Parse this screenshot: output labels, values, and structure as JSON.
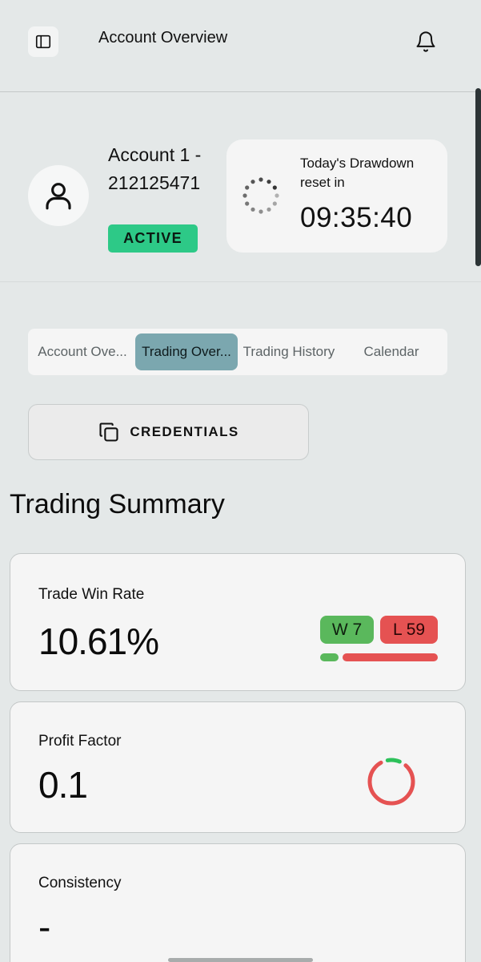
{
  "header": {
    "title": "Account Overview",
    "menu_icon": "sidebar-panel-icon",
    "notification_icon": "bell-icon"
  },
  "account": {
    "name": "Account 1 - 212125471",
    "status": "ACTIVE",
    "status_color": "#2dc987",
    "avatar_icon": "user-icon"
  },
  "drawdown": {
    "label": "Today's Drawdown reset in",
    "timer": "09:35:40",
    "icon": "loading-spinner-icon"
  },
  "tabs": [
    {
      "label": "Account Ove...",
      "active": false
    },
    {
      "label": "Trading Over...",
      "active": true
    },
    {
      "label": "Trading History",
      "active": false
    },
    {
      "label": "Calendar",
      "active": false
    }
  ],
  "credentials": {
    "label": "CREDENTIALS",
    "icon": "copy-icon"
  },
  "summary": {
    "title": "Trading Summary",
    "win_rate": {
      "label": "Trade Win Rate",
      "value": "10.61%",
      "wins_label": "W 7",
      "losses_label": "L 59",
      "wins": 7,
      "losses": 59,
      "win_color": "#5ab85c",
      "loss_color": "#e55252"
    },
    "profit_factor": {
      "label": "Profit Factor",
      "value": "0.1",
      "ring_fraction": 0.09
    },
    "consistency": {
      "label": "Consistency",
      "value": "-"
    }
  }
}
